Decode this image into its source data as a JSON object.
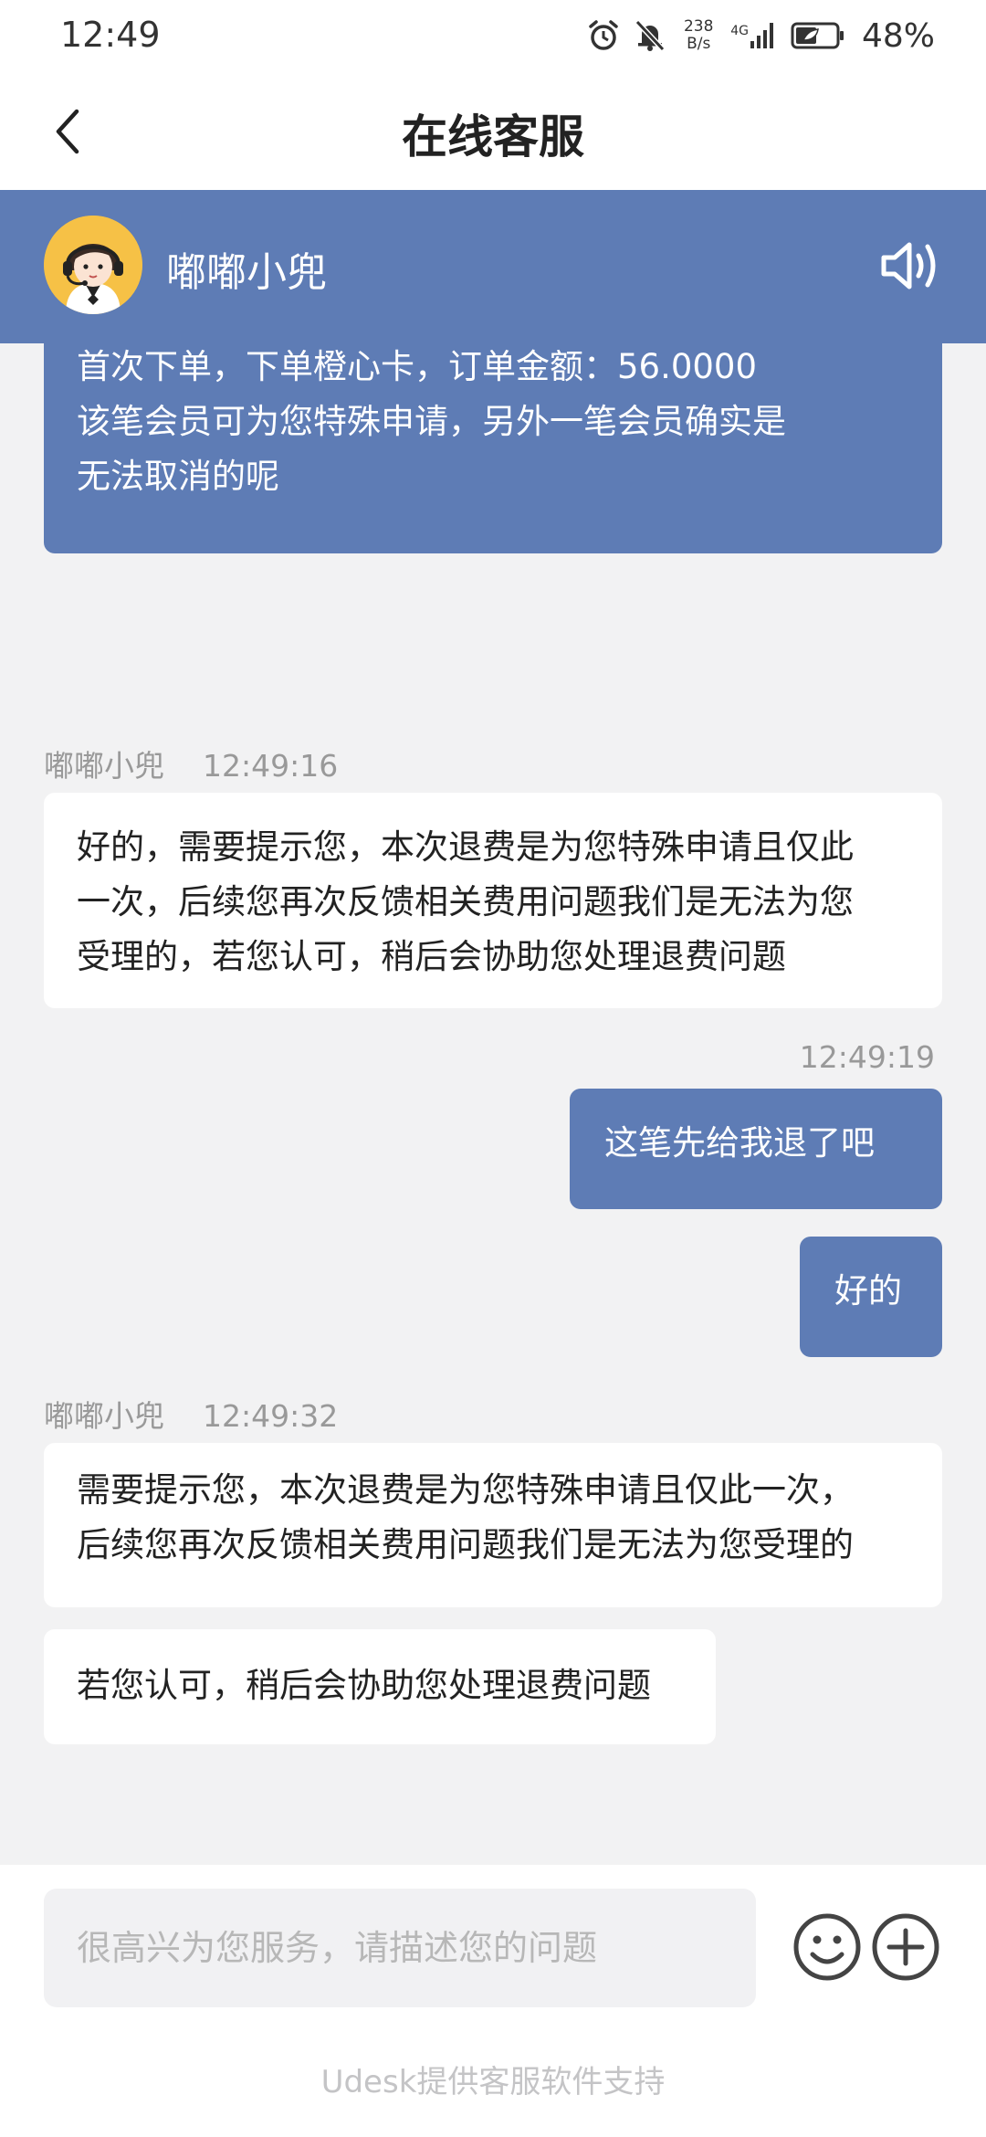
{
  "status_bar": {
    "time": "12:49",
    "net_speed_value": "238",
    "net_speed_unit": "B/s",
    "network": "4G",
    "battery": "48%"
  },
  "nav": {
    "title": "在线客服"
  },
  "agent": {
    "name": "嘟嘟小兜",
    "avatar_icon": "customer-service-avatar-icon",
    "sound_icon": "speaker-icon"
  },
  "chat": {
    "first_bubble_lines": [
      "首次下单，下单橙心卡，订单金额：56.0000",
      "该笔会员可为您特殊申请，另外一笔会员确实是",
      "无法取消的呢"
    ],
    "msg1_sender": "嘟嘟小兜",
    "msg1_time": "12:49:16",
    "msg1_lines": [
      "好的，需要提示您，本次退费是为您特殊申请且仅此",
      "一次，后续您再次反馈相关费用问题我们是无法为您",
      "受理的，若您认可，稍后会协助您处理退费问题"
    ],
    "msg2_time": "12:49:19",
    "msg2_text": "这笔先给我退了吧",
    "msg3_text": "好的",
    "msg4_sender": "嘟嘟小兜",
    "msg4_time": "12:49:32",
    "msg4_lines": [
      "需要提示您，本次退费是为您特殊申请且仅此一次，",
      "后续您再次反馈相关费用问题我们是无法为您受理的"
    ],
    "msg5_text": "若您认可，稍后会协助您处理退费问题"
  },
  "input": {
    "placeholder": "很高兴为您服务，请描述您的问题",
    "value": ""
  },
  "footer": {
    "powered_by": "Udesk提供客服软件支持"
  },
  "colors": {
    "accent": "#5e7cb5",
    "background": "#f2f2f3",
    "bubble_left": "#ffffff"
  }
}
